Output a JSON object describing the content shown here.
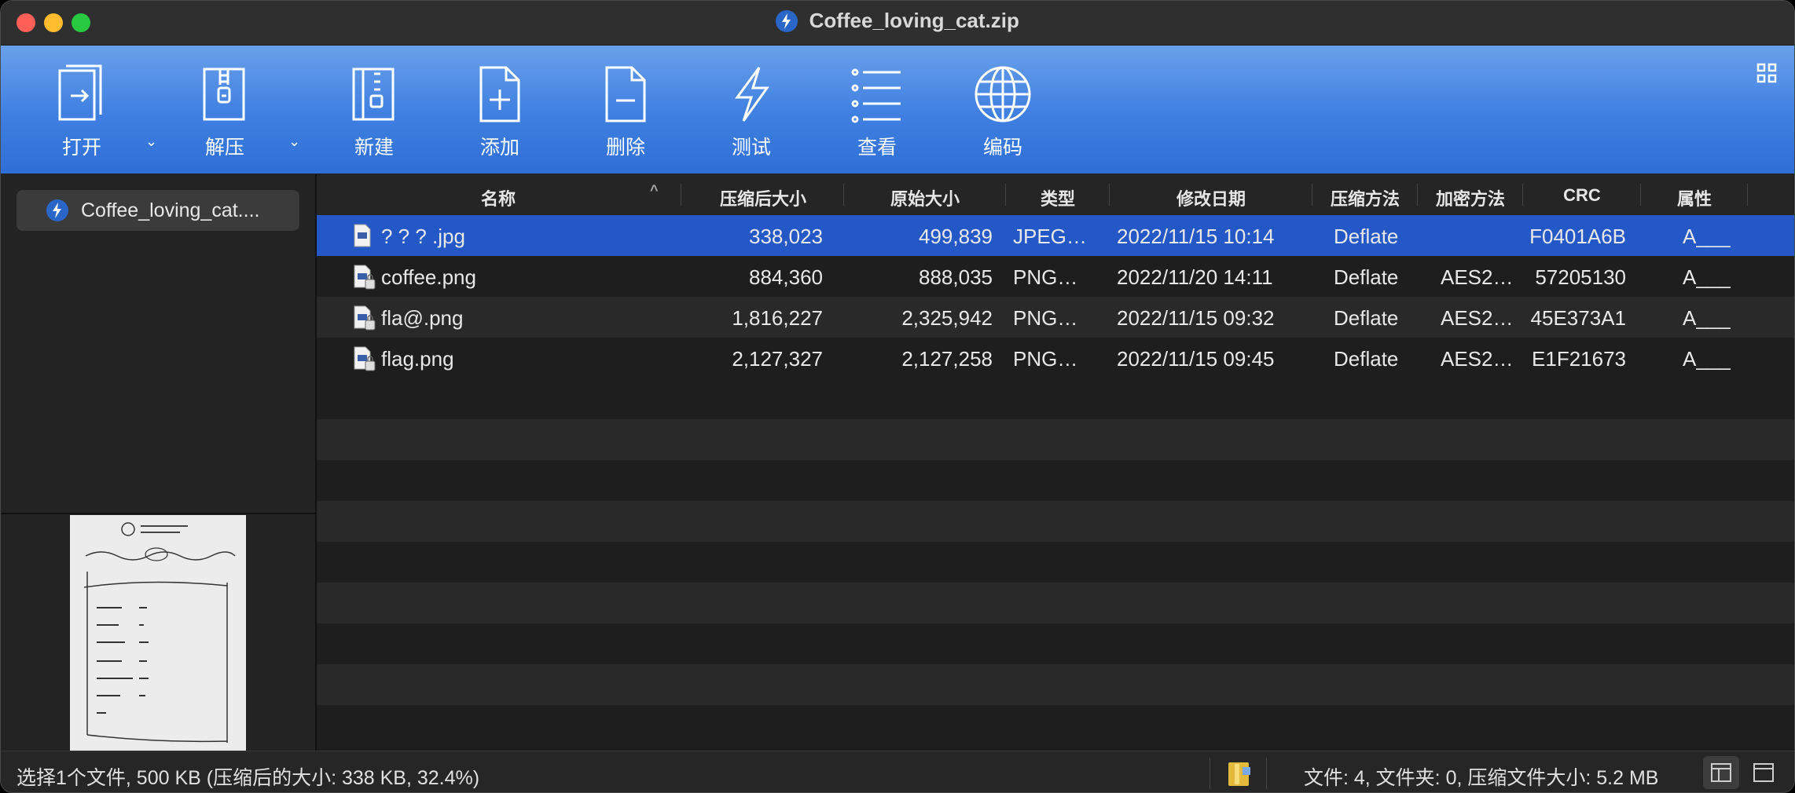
{
  "window": {
    "title": "Coffee_loving_cat.zip"
  },
  "toolbar": {
    "open_label": "打开",
    "extract_label": "解压",
    "new_label": "新建",
    "add_label": "添加",
    "delete_label": "删除",
    "test_label": "测试",
    "view_label": "查看",
    "encode_label": "编码"
  },
  "sidebar": {
    "archive_name": "Coffee_loving_cat...."
  },
  "columns": {
    "name": "名称",
    "packed": "压缩后大小",
    "original": "原始大小",
    "type": "类型",
    "modified": "修改日期",
    "method": "压缩方法",
    "encryption": "加密方法",
    "crc": "CRC",
    "attr": "属性"
  },
  "files": [
    {
      "name": "? ? ?  .jpg",
      "packed": "338,023",
      "original": "499,839",
      "type": "JPEG…",
      "modified": "2022/11/15 10:14",
      "method": "Deflate",
      "encryption": "",
      "crc": "F0401A6B",
      "attr": "A___",
      "locked": false,
      "selected": true
    },
    {
      "name": "coffee.png",
      "packed": "884,360",
      "original": "888,035",
      "type": "PNG…",
      "modified": "2022/11/20 14:11",
      "method": "Deflate",
      "encryption": "AES2…",
      "crc": "57205130",
      "attr": "A___",
      "locked": true,
      "selected": false
    },
    {
      "name": "fla@.png",
      "packed": "1,816,227",
      "original": "2,325,942",
      "type": "PNG…",
      "modified": "2022/11/15 09:32",
      "method": "Deflate",
      "encryption": "AES2…",
      "crc": "45E373A1",
      "attr": "A___",
      "locked": true,
      "selected": false
    },
    {
      "name": "flag.png",
      "packed": "2,127,327",
      "original": "2,127,258",
      "type": "PNG…",
      "modified": "2022/11/15 09:45",
      "method": "Deflate",
      "encryption": "AES2…",
      "crc": "E1F21673",
      "attr": "A___",
      "locked": true,
      "selected": false
    }
  ],
  "status": {
    "selection": "选择1个文件, 500 KB (压缩后的大小: 338 KB, 32.4%)",
    "summary": "文件: 4, 文件夹: 0, 压缩文件大小: 5.2 MB"
  },
  "icons": {
    "title": "archive-app-icon",
    "open": "open-file-icon",
    "extract": "zipper-icon",
    "new": "new-archive-icon",
    "add": "add-file-icon",
    "delete": "delete-file-icon",
    "test": "lightning-icon",
    "view": "list-icon",
    "encode": "globe-icon"
  },
  "colors": {
    "toolbar": "#3e7fe0",
    "selection": "#2458c6"
  }
}
